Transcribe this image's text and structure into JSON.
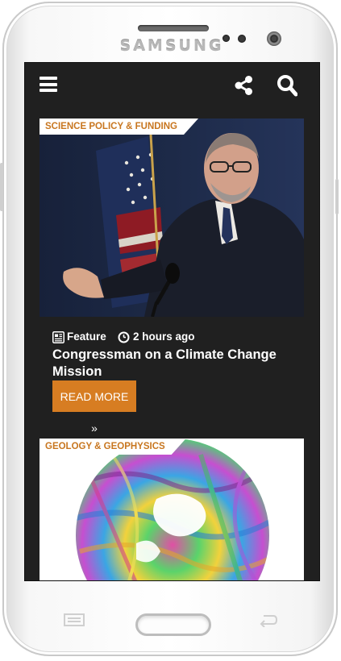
{
  "device": {
    "brand": "SAMSUNG"
  },
  "appbar": {
    "menu_icon": "hamburger-menu-icon",
    "share_icon": "share-icon",
    "search_icon": "search-icon"
  },
  "articles": [
    {
      "category": "SCIENCE POLICY & FUNDING",
      "image": "congressman-speaking-at-podium-with-flag",
      "meta_type": "Feature",
      "meta_type_icon": "newspaper-icon",
      "meta_time": "2 hours ago",
      "meta_time_icon": "clock-icon",
      "title": "Congressman on a Climate Change Mission",
      "cta": "READ MORE »"
    },
    {
      "category": "GEOLOGY & GEOPHYSICS",
      "image": "colorful-geophysical-polar-map"
    }
  ],
  "colors": {
    "accent": "#d77d22",
    "background": "#202020",
    "tag_text": "#c8761f"
  }
}
